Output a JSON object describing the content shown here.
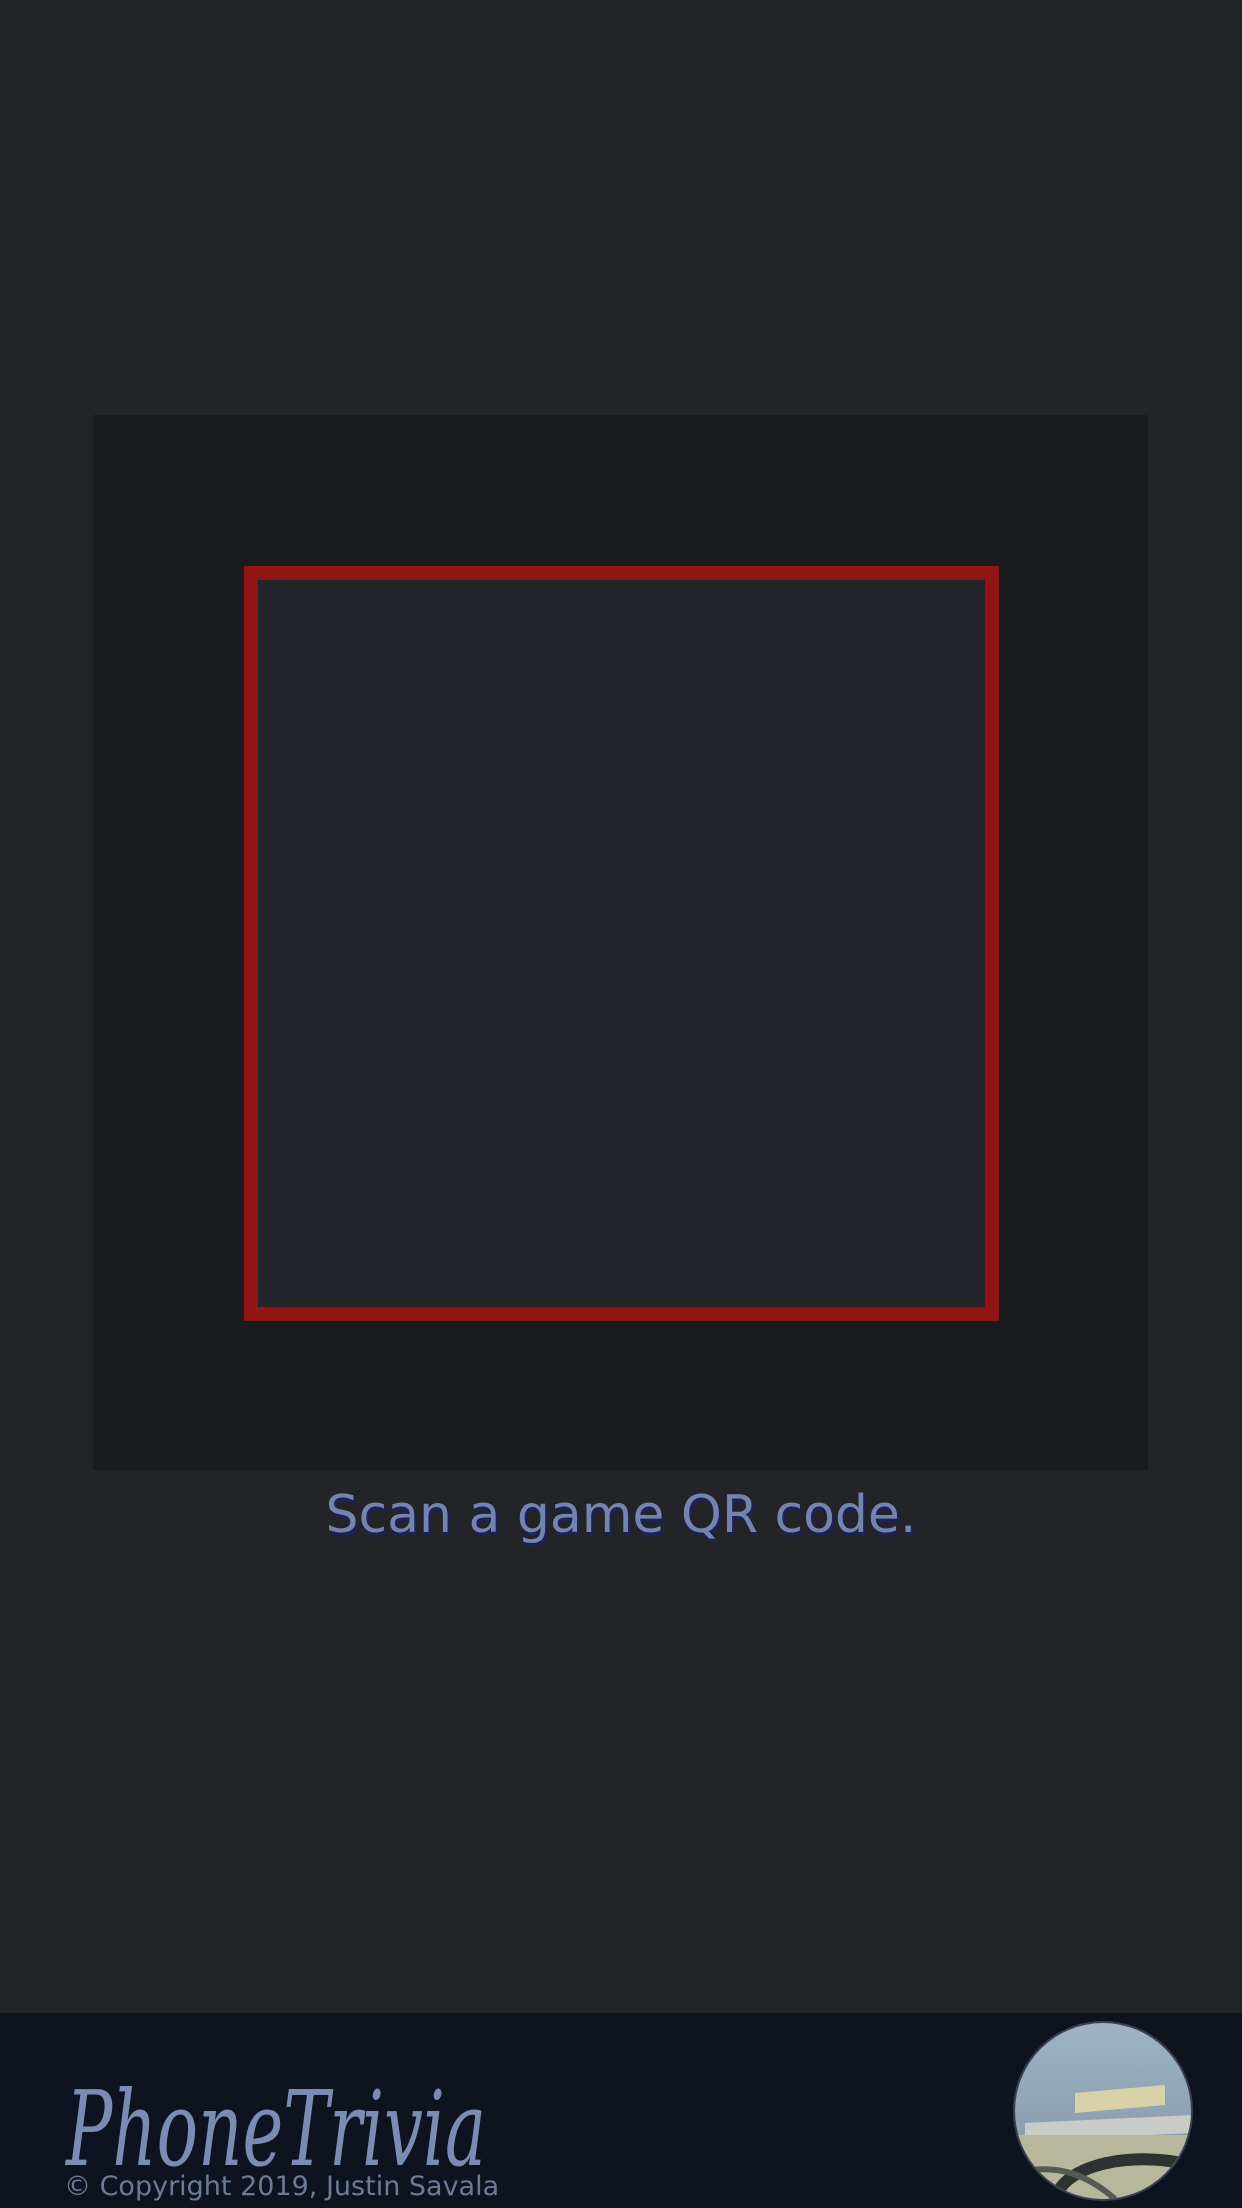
{
  "scanner": {
    "instruction": "Scan a game QR code.",
    "frame_color": "#921515"
  },
  "footer": {
    "logo_text": "PhoneTrivia",
    "copyright": "© Copyright 2019, Justin Savala",
    "avatar_icon": "user-avatar-photo"
  },
  "colors": {
    "background": "#222428",
    "viewport": "#191b1e",
    "footer": "#0d1420",
    "text": "#7385ae"
  }
}
